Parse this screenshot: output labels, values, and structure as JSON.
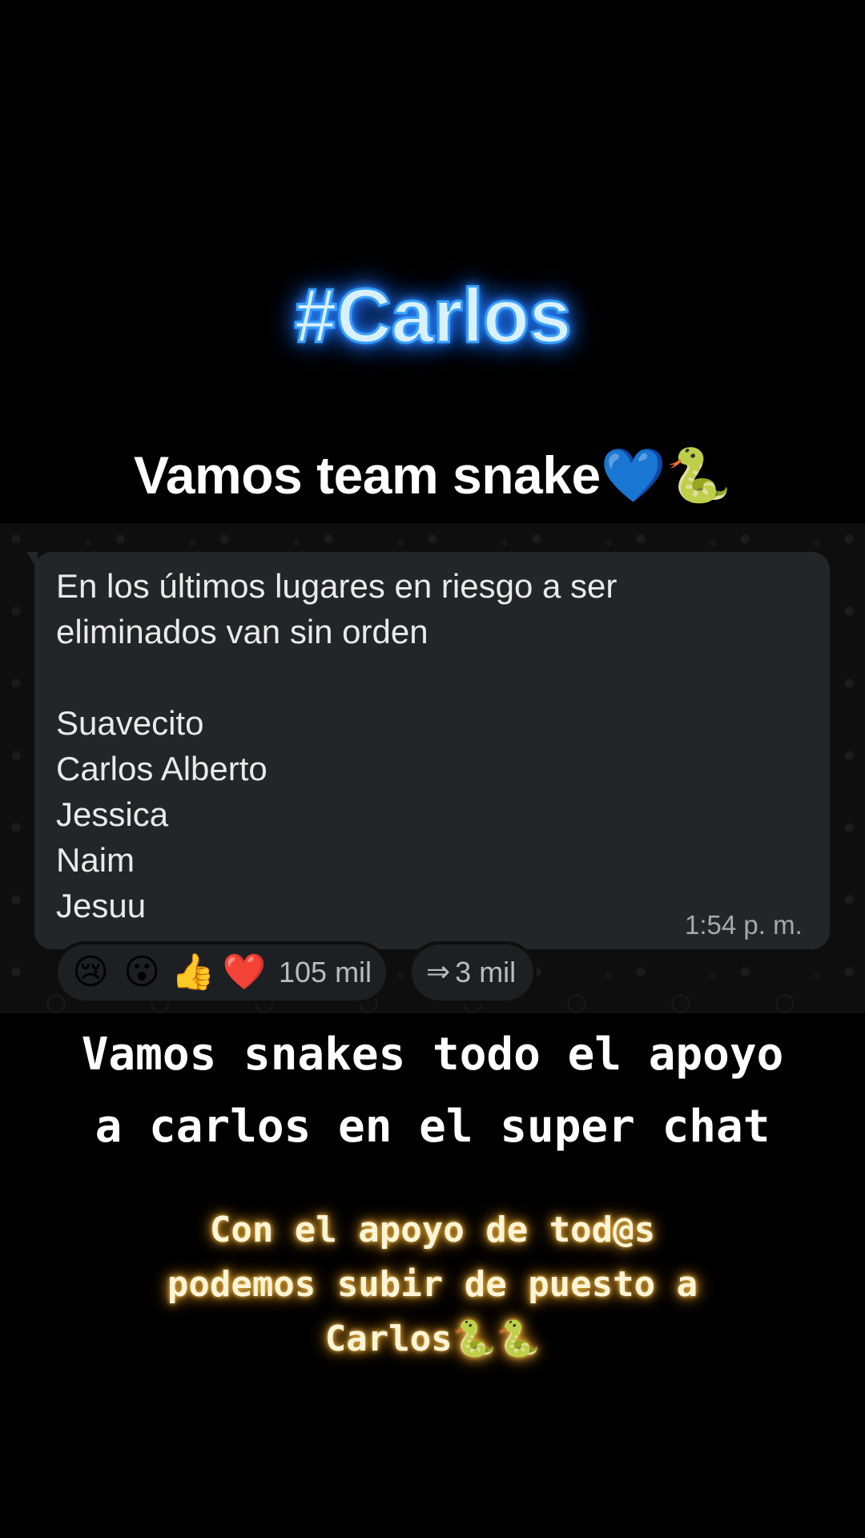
{
  "overlay": {
    "hashtag": "#Carlos",
    "team_line": "Vamos team snake💙🐍",
    "caption_main": "Vamos snakes todo el apoyo\na carlos en el super chat",
    "caption_sub": "Con el apoyo de tod@s\npodemos subir de puesto a\nCarlos🐍🐍"
  },
  "message": {
    "text": "En los últimos lugares en riesgo a ser\neliminados van sin orden\n\nSuavecito\nCarlos Alberto\nJessica\nNaim\nJesuu",
    "time": "1:54 p. m.",
    "reactions": {
      "emojis": [
        "😢",
        "😮",
        "👍",
        "❤️"
      ],
      "count": "105 mil"
    },
    "forwards": {
      "icon": "forward-arrow-icon",
      "count": "3 mil"
    }
  },
  "colors": {
    "background": "#000000",
    "bubble": "#222629",
    "hashtag_glow": "#2f8cff",
    "caption_glow": "#e8b64a"
  }
}
